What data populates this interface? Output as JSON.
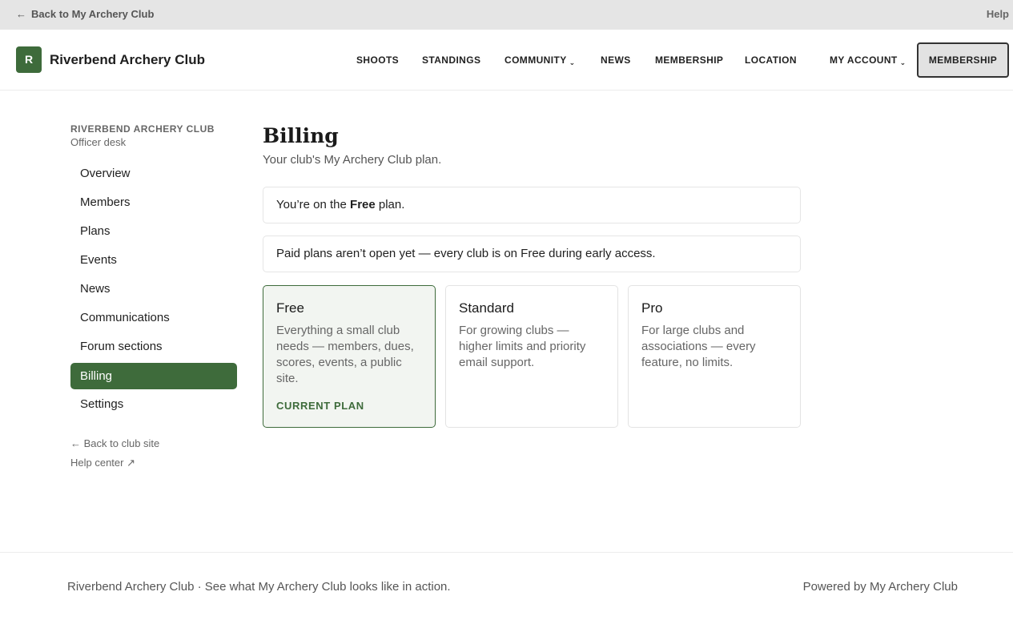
{
  "topbar": {
    "back_arrow": "←",
    "back_label": "Back to My Archery Club",
    "help_label": "Help"
  },
  "header": {
    "logo_letter": "R",
    "brand": "Riverbend Archery Club",
    "nav": {
      "shoots": "SHOOTS",
      "standings": "STANDINGS",
      "community": "COMMUNITY",
      "news": "NEWS",
      "membership": "MEMBERSHIP",
      "location": "LOCATION",
      "my_account": "MY ACCOUNT",
      "caret": "⌄"
    },
    "membership_button": "MEMBERSHIP"
  },
  "sidebar": {
    "club_name": "RIVERBEND ARCHERY CLUB",
    "club_sub": "Officer desk",
    "items": [
      {
        "label": "Overview"
      },
      {
        "label": "Members"
      },
      {
        "label": "Plans"
      },
      {
        "label": "Events"
      },
      {
        "label": "News"
      },
      {
        "label": "Communications"
      },
      {
        "label": "Forum sections"
      },
      {
        "label": "Billing"
      },
      {
        "label": "Settings"
      }
    ],
    "back_link": "← Back to club site",
    "help_link": "Help center ↗"
  },
  "main": {
    "title": "Billing",
    "subtitle": "Your club's My Archery Club plan.",
    "plan_notice_prefix": "You’re on the ",
    "plan_notice_plan": "Free",
    "plan_notice_suffix": " plan.",
    "early_access_notice": "Paid plans aren’t open yet — every club is on Free during early access.",
    "plans": [
      {
        "name": "Free",
        "description": "Everything a small club needs — members, dues, scores, events, a public site.",
        "badge": "CURRENT PLAN"
      },
      {
        "name": "Standard",
        "description": "For growing clubs — higher limits and priority email support."
      },
      {
        "name": "Pro",
        "description": "For large clubs and associations — every feature, no limits."
      }
    ]
  },
  "footer": {
    "left": "Riverbend Archery Club · See what My Archery Club looks like in action.",
    "right": "Powered by My Archery Club"
  },
  "colors": {
    "accent": "#3e6b3b",
    "topbar_bg": "#e5e5e5",
    "current_card_bg": "#f2f5f1"
  }
}
